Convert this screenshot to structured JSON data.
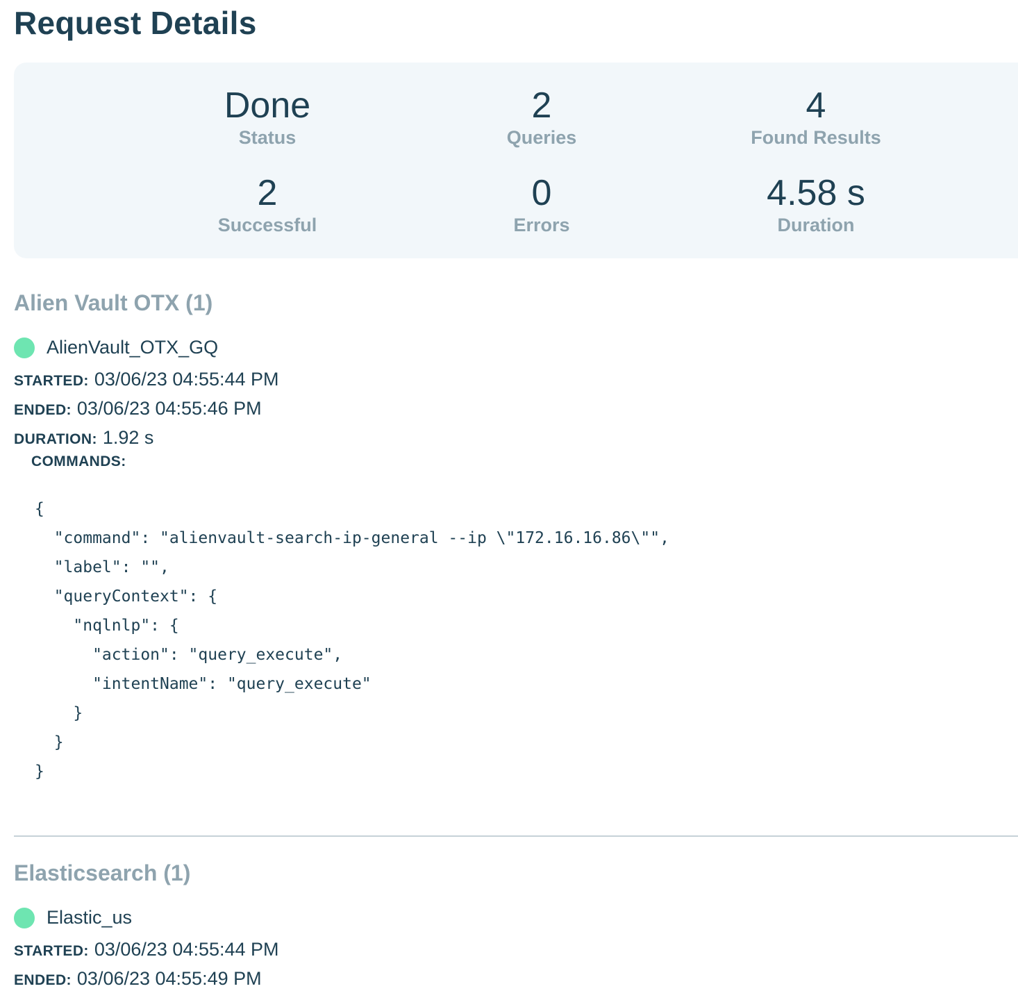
{
  "page": {
    "title": "Request Details"
  },
  "summary": {
    "status": {
      "value": "Done",
      "label": "Status"
    },
    "queries": {
      "value": "2",
      "label": "Queries"
    },
    "found_results": {
      "value": "4",
      "label": "Found Results"
    },
    "successful": {
      "value": "2",
      "label": "Successful"
    },
    "errors": {
      "value": "0",
      "label": "Errors"
    },
    "duration": {
      "value": "4.58 s",
      "label": "Duration"
    }
  },
  "labels": {
    "started": "Started:",
    "ended": "Ended:",
    "duration": "Duration:",
    "commands": "Commands:"
  },
  "sections": [
    {
      "title": "Alien Vault OTX (1)",
      "source": {
        "name": "AlienVault_OTX_GQ",
        "status_color": "#6ee5b1",
        "started": "03/06/23 04:55:44 PM",
        "ended": "03/06/23 04:55:46 PM",
        "duration": "1.92 s",
        "commands": "{\n  \"command\": \"alienvault-search-ip-general --ip \\\"172.16.16.86\\\"\",\n  \"label\": \"\",\n  \"queryContext\": {\n    \"nqlnlp\": {\n      \"action\": \"query_execute\",\n      \"intentName\": \"query_execute\"\n    }\n  }\n}"
      }
    },
    {
      "title": "Elasticsearch (1)",
      "source": {
        "name": "Elastic_us",
        "status_color": "#6ee5b1",
        "started": "03/06/23 04:55:44 PM",
        "ended": "03/06/23 04:55:49 PM"
      }
    }
  ]
}
